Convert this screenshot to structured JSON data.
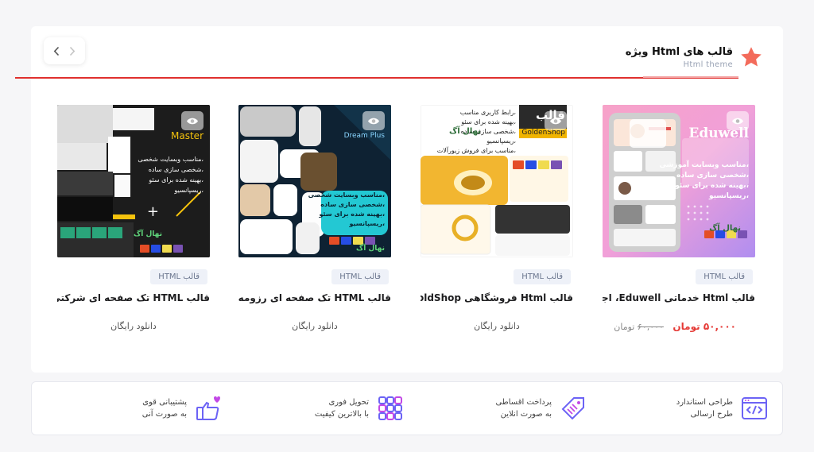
{
  "section": {
    "title": "قالب های Html ویژه",
    "subtitle": "Html theme",
    "accent_color": "#e0302e",
    "star_color": "#f36b5b"
  },
  "nav": {
    "prev_icon": "chevron-left-icon",
    "next_icon": "chevron-right-icon"
  },
  "products": [
    {
      "badge": "قالب HTML",
      "title": "قالب Html خدماتی Eduwell، اجوول",
      "price_old": "۶۰,۰۰۰",
      "price_old_unit": "تومان",
      "price_new": "۵۰,۰۰۰ تومان",
      "thumb": {
        "brand": "Eduwell",
        "lines": [
          "،مناسب وبسایت آموزشی",
          "،شخصی سازی ساده",
          "،بهینه شده برای سئو",
          "،ریسپانسیو"
        ],
        "logo": "نهال آگ"
      }
    },
    {
      "badge": "قالب HTML",
      "title": "قالب Html فروشگاهی GoldShop،",
      "meta": "دانلود رایگان",
      "thumb": {
        "brand": "قالب",
        "brand_sub": "GoldenShop",
        "lines": [
          "،رابط کاربری مناسب",
          "،بهینه شده برای سئو",
          "،شخصی سازی ساده",
          "،ریسپانسیو",
          "،مناسب برای فروش زیورآلات"
        ],
        "logo": "نهال آگ"
      }
    },
    {
      "badge": "قالب HTML",
      "title": "قالب HTML تک صفحه ای رزومه ای نبض",
      "meta": "دانلود رایگان",
      "thumb": {
        "brand": "Dream Plus",
        "lines": [
          "،مناسب وبسایت شخصی",
          "،شخصی سازی ساده",
          "،بهینه شده برای سئو",
          "،ریسپانسیو"
        ],
        "logo": "نهال آگ"
      }
    },
    {
      "badge": "قالب HTML",
      "title": "قالب HTML تک صفحه ای شرکتی مستر ،",
      "meta": "دانلود رایگان",
      "thumb": {
        "brand": "Master",
        "lines": [
          "،مناسب وبسایت شخصی",
          "،شخصی سازی ساده",
          "،بهینه شده برای سئو",
          "،ریسپانسیو"
        ],
        "logo": "نهال آگ"
      }
    }
  ],
  "features": [
    {
      "line1": "طراحی استاندارد",
      "line2": "طرح ارسالی",
      "icon": "code-window-icon"
    },
    {
      "line1": "پرداخت اقساطی",
      "line2": "به صورت انلاین",
      "icon": "discount-tag-icon"
    },
    {
      "line1": "تحویل فوری",
      "line2": "با بالاترین کیفیت",
      "icon": "grid-apps-icon"
    },
    {
      "line1": "پشتیبانی قوی",
      "line2": "به صورت آنی",
      "icon": "thumbs-up-heart-icon"
    }
  ],
  "colors": {
    "feature_icon": "#6c63f5",
    "feature_icon_alt": "#c248e6",
    "price": "#e53935"
  }
}
